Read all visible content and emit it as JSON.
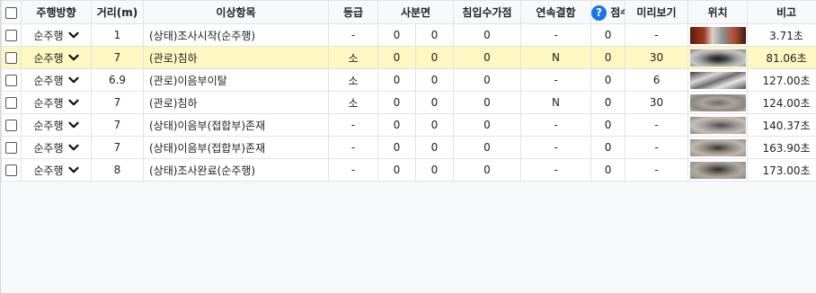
{
  "columns": {
    "direction": "주행방향",
    "distance": "거리(m)",
    "item": "이상항목",
    "grade": "등급",
    "sabun": "사분면",
    "infiltration": "침입수가점",
    "continuous": "연속결함",
    "help": "?",
    "score": "점수",
    "preview": "미리보기",
    "position": "위치",
    "notes": "비고"
  },
  "rows": [
    {
      "direction": "순주행",
      "distance": "1",
      "item": "(상태)조사시작(순주행)",
      "grade": "-",
      "q1": "0",
      "q2": "0",
      "infiltration": "0",
      "continuous": "-",
      "help_val": "0",
      "score": "-",
      "position": "3.71초",
      "notes": "",
      "preview_icon": "pipe-start-thumbnail"
    },
    {
      "direction": "순주행",
      "distance": "7",
      "item": "(관로)침하",
      "grade": "소",
      "q1": "0",
      "q2": "0",
      "infiltration": "0",
      "continuous": "N",
      "help_val": "0",
      "score": "30",
      "position": "81.06초",
      "notes": "",
      "preview_icon": "pipe-interior-thumbnail"
    },
    {
      "direction": "순주행",
      "distance": "6.9",
      "item": "(관로)이음부이탈",
      "grade": "소",
      "q1": "0",
      "q2": "0",
      "infiltration": "0",
      "continuous": "-",
      "help_val": "0",
      "score": "6",
      "position": "127.00초",
      "notes": "",
      "preview_icon": "pipe-interior-thumbnail"
    },
    {
      "direction": "순주행",
      "distance": "7",
      "item": "(관로)침하",
      "grade": "소",
      "q1": "0",
      "q2": "0",
      "infiltration": "0",
      "continuous": "N",
      "help_val": "0",
      "score": "30",
      "position": "124.00초",
      "notes": "",
      "preview_icon": "pipe-interior-thumbnail"
    },
    {
      "direction": "순주행",
      "distance": "7",
      "item": "(상태)이음부(접합부)존재",
      "grade": "-",
      "q1": "0",
      "q2": "0",
      "infiltration": "0",
      "continuous": "-",
      "help_val": "0",
      "score": "-",
      "position": "140.37초",
      "notes": "",
      "preview_icon": "pipe-interior-thumbnail"
    },
    {
      "direction": "순주행",
      "distance": "7",
      "item": "(상태)이음부(접합부)존재",
      "grade": "-",
      "q1": "0",
      "q2": "0",
      "infiltration": "0",
      "continuous": "-",
      "help_val": "0",
      "score": "-",
      "position": "163.90초",
      "notes": "",
      "preview_icon": "pipe-interior-thumbnail"
    },
    {
      "direction": "순주행",
      "distance": "8",
      "item": "(상태)조사완료(순주행)",
      "grade": "-",
      "q1": "0",
      "q2": "0",
      "infiltration": "0",
      "continuous": "-",
      "help_val": "0",
      "score": "-",
      "position": "173.00초",
      "notes": "",
      "preview_icon": "pipe-interior-thumbnail"
    }
  ],
  "highlighted_row": 1,
  "colors": {
    "highlight": "#fdf7c2",
    "help_badge": "#1a73e8",
    "border": "#e1e3e6"
  }
}
